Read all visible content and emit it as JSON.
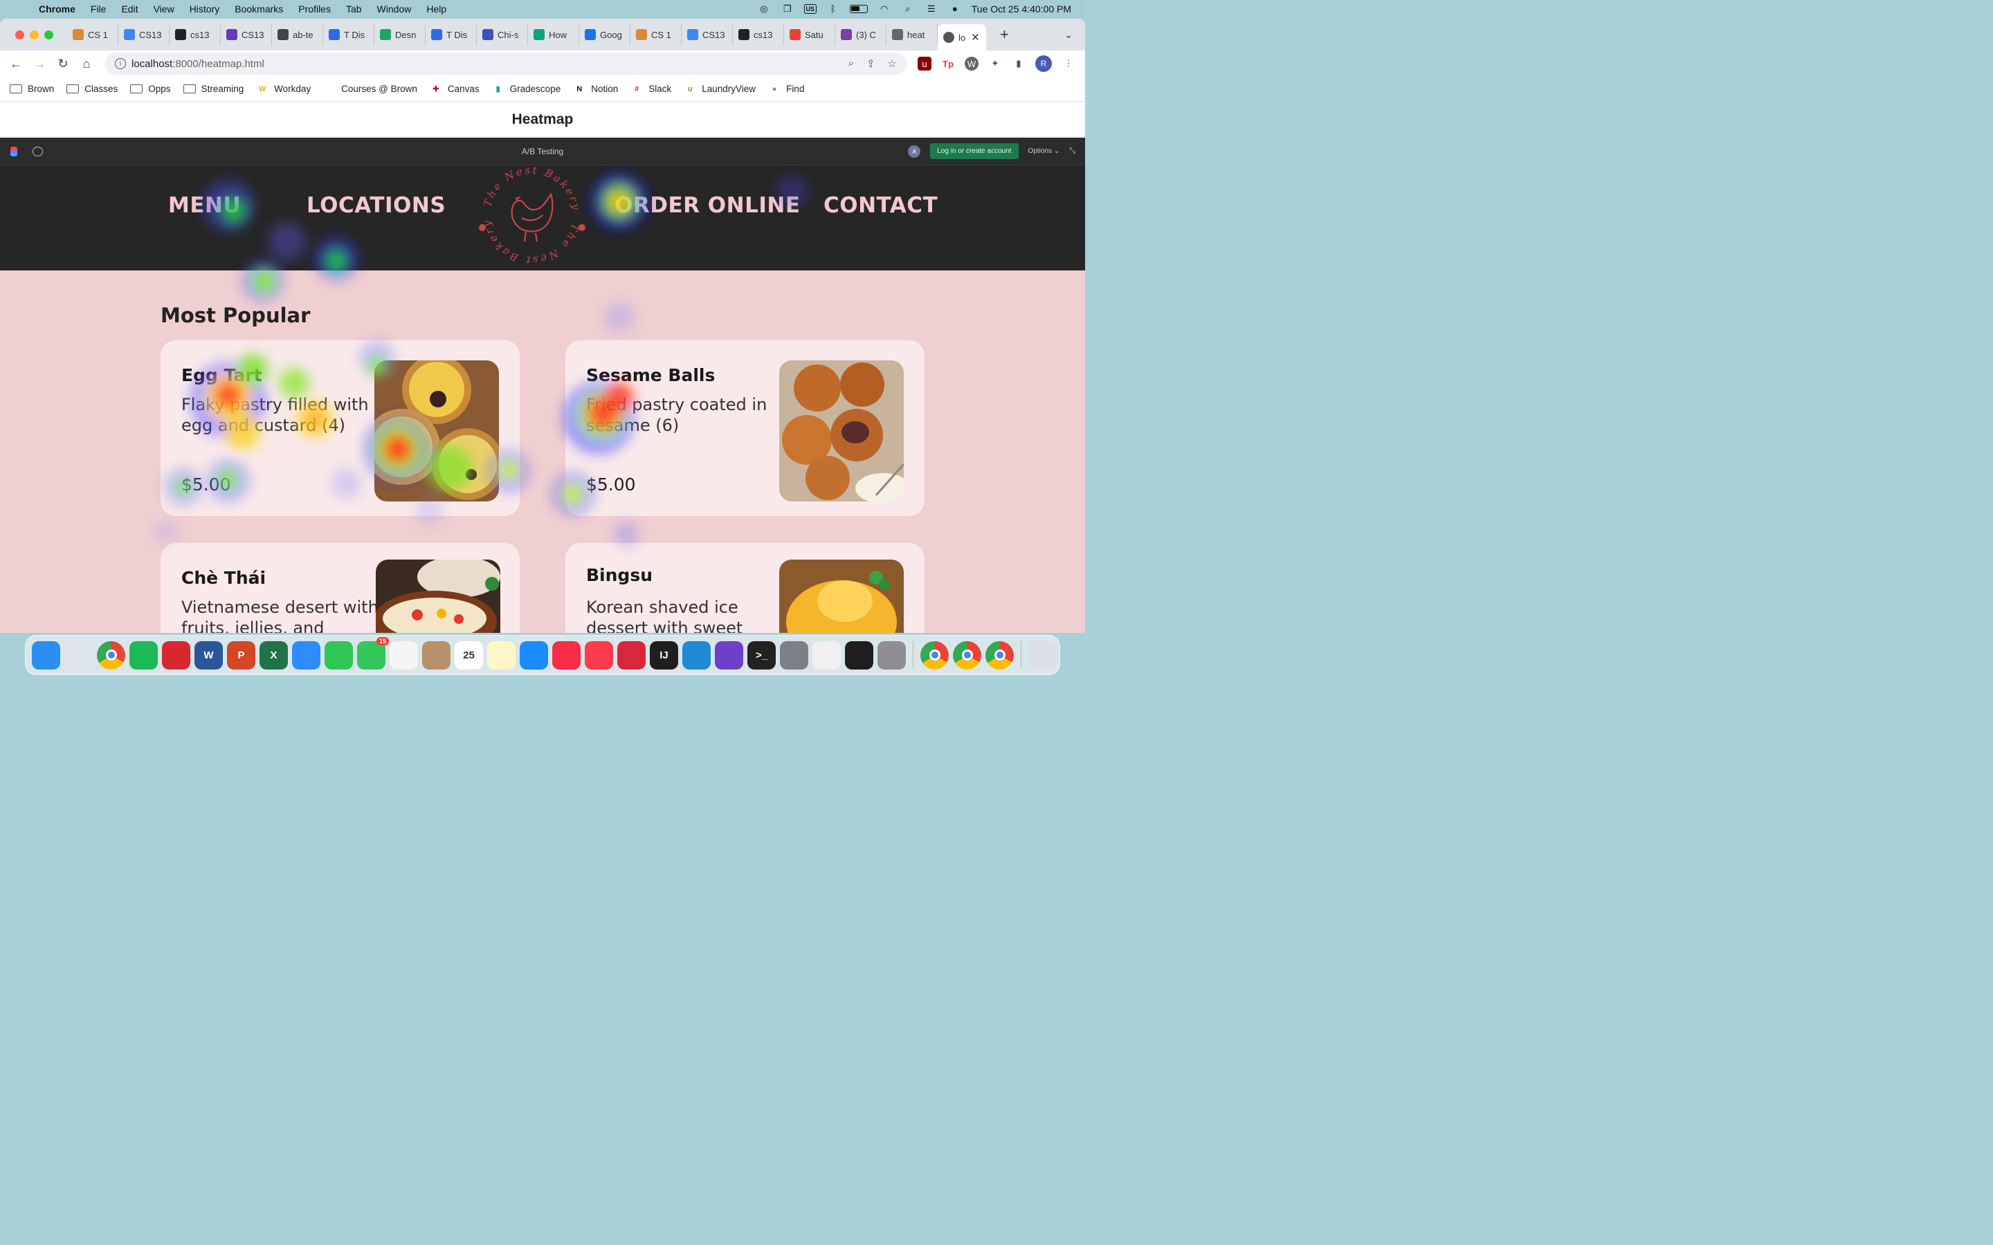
{
  "menubar": {
    "app_name": "Chrome",
    "items": [
      "File",
      "Edit",
      "View",
      "History",
      "Bookmarks",
      "Profiles",
      "Tab",
      "Window",
      "Help"
    ],
    "input_indicator": "US",
    "datetime": "Tue Oct 25  4:40:00 PM"
  },
  "tabs": [
    {
      "label": "CS 1",
      "color": "#d98a3a",
      "icon": "bakery-icon"
    },
    {
      "label": "CS13",
      "color": "#4285f4",
      "icon": "docs-icon"
    },
    {
      "label": "cs13",
      "color": "#222222",
      "icon": "github-icon"
    },
    {
      "label": "CS13",
      "color": "#673ab7",
      "icon": "forms-icon"
    },
    {
      "label": "ab-te",
      "color": "#444444",
      "icon": "vercel-icon"
    },
    {
      "label": "T Dis",
      "color": "#2e6be6",
      "icon": "st-icon"
    },
    {
      "label": "Desn",
      "color": "#1fa463",
      "icon": "sheets-icon"
    },
    {
      "label": "T Dis",
      "color": "#2e6be6",
      "icon": "st-icon"
    },
    {
      "label": "Chi-s",
      "color": "#3f51b5",
      "icon": "grid-icon"
    },
    {
      "label": "How",
      "color": "#10a37f",
      "icon": "openai-icon"
    },
    {
      "label": "Goog",
      "color": "#1a73e8",
      "icon": "calendar-icon"
    },
    {
      "label": "CS 1",
      "color": "#d98a3a",
      "icon": "bakery-icon"
    },
    {
      "label": "CS13",
      "color": "#4285f4",
      "icon": "docs-icon"
    },
    {
      "label": "cs13",
      "color": "#222222",
      "icon": "github-icon"
    },
    {
      "label": "Satu",
      "color": "#ea4335",
      "icon": "gmail-icon"
    },
    {
      "label": "(3) C",
      "color": "#7b3fa0",
      "icon": "ed-icon"
    },
    {
      "label": "heat",
      "color": "#666666",
      "icon": "globe-icon"
    }
  ],
  "active_tab": {
    "label": "lo"
  },
  "address": {
    "host": "localhost",
    "path": ":8000/heatmap.html"
  },
  "bookmarks": [
    {
      "label": "Brown",
      "icon": "folder-icon"
    },
    {
      "label": "Classes",
      "icon": "folder-icon"
    },
    {
      "label": "Opps",
      "icon": "folder-icon"
    },
    {
      "label": "Streaming",
      "icon": "folder-icon"
    },
    {
      "label": "Workday",
      "icon": "workday-icon"
    },
    {
      "label": "Courses @ Brown",
      "icon": "none"
    },
    {
      "label": "Canvas",
      "icon": "canvas-icon"
    },
    {
      "label": "Gradescope",
      "icon": "gradescope-icon"
    },
    {
      "label": "Notion",
      "icon": "notion-icon"
    },
    {
      "label": "Slack",
      "icon": "slack-icon"
    },
    {
      "label": "LaundryView",
      "icon": "laundry-icon"
    },
    {
      "label": "Find",
      "icon": "apple-icon"
    }
  ],
  "page": {
    "title": "Heatmap"
  },
  "figma": {
    "title": "A/B Testing",
    "avatar": "A",
    "login": "Log in or create account",
    "options": "Options"
  },
  "site": {
    "nav": {
      "menu": "MENU",
      "locations": "LOCATIONS",
      "order": "ORDER ONLINE",
      "contact": "CONTACT"
    },
    "logo_text": "The Nest Bakery",
    "section_title": "Most Popular",
    "cards": [
      {
        "name": "Egg Tart",
        "desc": "Flaky pastry filled with egg and custard (4)",
        "price": "$5.00"
      },
      {
        "name": "Sesame Balls",
        "desc": "Fried pastry coated in sesame (6)",
        "price": "$5.00"
      },
      {
        "name": "Chè Thái",
        "desc": "Vietnamese desert with fruits, jellies, and",
        "price": ""
      },
      {
        "name": "Bingsu",
        "desc": "Korean shaved ice dessert with sweet",
        "price": ""
      }
    ]
  },
  "dock": [
    {
      "name": "finder-icon",
      "color": "#2b8ef0",
      "glyph": ""
    },
    {
      "name": "launchpad-icon",
      "color": "#dfe3ea",
      "glyph": ""
    },
    {
      "name": "chrome-icon",
      "color": "#e8eaed",
      "glyph": ""
    },
    {
      "name": "spotify-icon",
      "color": "#1db954",
      "glyph": ""
    },
    {
      "name": "acrobat-icon",
      "color": "#d7282f",
      "glyph": ""
    },
    {
      "name": "word-icon",
      "color": "#2b579a",
      "glyph": "W"
    },
    {
      "name": "powerpoint-icon",
      "color": "#d24726",
      "glyph": "P"
    },
    {
      "name": "excel-icon",
      "color": "#217346",
      "glyph": "X"
    },
    {
      "name": "zoom-icon",
      "color": "#2d8cff",
      "glyph": ""
    },
    {
      "name": "facetime-icon",
      "color": "#30c653",
      "glyph": ""
    },
    {
      "name": "messages-icon",
      "color": "#34c759",
      "glyph": "",
      "badge": "15"
    },
    {
      "name": "photos-icon",
      "color": "#f5f5f5",
      "glyph": ""
    },
    {
      "name": "contacts-icon",
      "color": "#b8916a",
      "glyph": ""
    },
    {
      "name": "calendar-icon",
      "color": "#ffffff",
      "glyph": "25"
    },
    {
      "name": "notes-icon",
      "color": "#fff7c8",
      "glyph": ""
    },
    {
      "name": "appstore-icon",
      "color": "#1a8cff",
      "glyph": ""
    },
    {
      "name": "music-icon",
      "color": "#fa2d48",
      "glyph": ""
    },
    {
      "name": "news-icon",
      "color": "#ff3b4e",
      "glyph": ""
    },
    {
      "name": "photobooth-icon",
      "color": "#d8263a",
      "glyph": ""
    },
    {
      "name": "intellij-icon",
      "color": "#1f1f1f",
      "glyph": "IJ"
    },
    {
      "name": "vscode-icon",
      "color": "#1f8ad2",
      "glyph": ""
    },
    {
      "name": "github-desktop-icon",
      "color": "#6e40c9",
      "glyph": ""
    },
    {
      "name": "terminal-icon",
      "color": "#222222",
      "glyph": ">_"
    },
    {
      "name": "gamecontroller-icon",
      "color": "#7c7f86",
      "glyph": ""
    },
    {
      "name": "facefind-icon",
      "color": "#f0f0f0",
      "glyph": ""
    },
    {
      "name": "figma-icon",
      "color": "#1e1e1e",
      "glyph": ""
    },
    {
      "name": "system-settings-icon",
      "color": "#8e8e93",
      "glyph": ""
    },
    {
      "name": "chrome-profile-1-icon",
      "color": "#e8eaed",
      "glyph": ""
    },
    {
      "name": "chrome-profile-2-icon",
      "color": "#e8eaed",
      "glyph": ""
    },
    {
      "name": "chrome-profile-3-icon",
      "color": "#e8eaed",
      "glyph": ""
    },
    {
      "name": "trash-icon",
      "color": "#dcdfe3",
      "glyph": ""
    }
  ]
}
